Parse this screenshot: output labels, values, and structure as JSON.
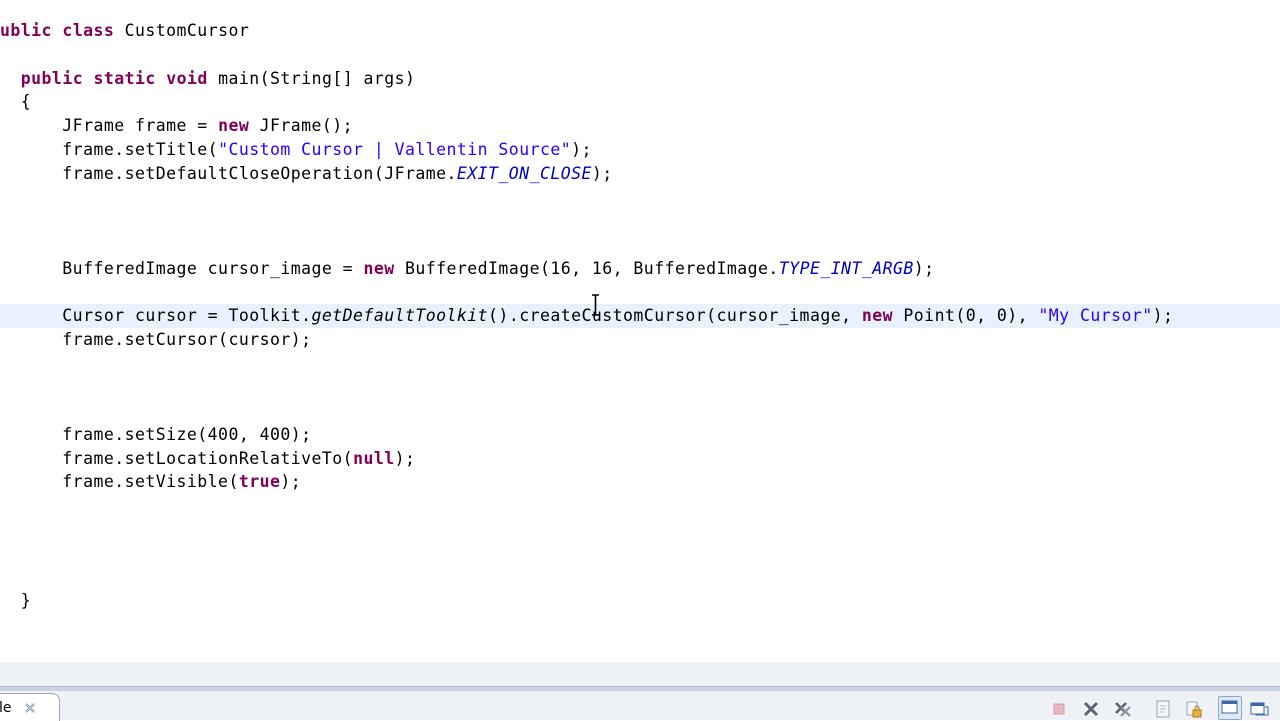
{
  "editor": {
    "lines": [
      [
        {
          "t": "ublic",
          "c": "kw"
        },
        {
          "t": " "
        },
        {
          "t": "class",
          "c": "kw"
        },
        {
          "t": " CustomCursor"
        }
      ],
      [],
      [
        {
          "t": "  "
        },
        {
          "t": "public",
          "c": "kw"
        },
        {
          "t": " "
        },
        {
          "t": "static",
          "c": "kw"
        },
        {
          "t": " "
        },
        {
          "t": "void",
          "c": "kw"
        },
        {
          "t": " main(String[] args)"
        }
      ],
      [
        {
          "t": "  {"
        }
      ],
      [
        {
          "t": "      JFrame frame = "
        },
        {
          "t": "new",
          "c": "kw"
        },
        {
          "t": " JFrame();"
        }
      ],
      [
        {
          "t": "      frame.setTitle("
        },
        {
          "t": "\"Custom Cursor | Vallentin Source\"",
          "c": "str"
        },
        {
          "t": ");"
        }
      ],
      [
        {
          "t": "      frame.setDefaultCloseOperation(JFrame."
        },
        {
          "t": "EXIT_ON_CLOSE",
          "c": "static"
        },
        {
          "t": ");"
        }
      ],
      [],
      [],
      [],
      [
        {
          "t": "      BufferedImage cursor_image = "
        },
        {
          "t": "new",
          "c": "kw"
        },
        {
          "t": " BufferedImage(16, 16, BufferedImage."
        },
        {
          "t": "TYPE_INT_ARGB",
          "c": "static"
        },
        {
          "t": ");"
        }
      ],
      [],
      [
        {
          "t": "      Cursor cursor = Toolkit."
        },
        {
          "t": "getDefaultToolkit",
          "c": "smethod"
        },
        {
          "t": "().createCustomCursor(cursor_image, "
        },
        {
          "t": "new",
          "c": "kw"
        },
        {
          "t": " Point(0, 0), "
        },
        {
          "t": "\"My Cursor\"",
          "c": "str"
        },
        {
          "t": ");"
        }
      ],
      [
        {
          "t": "      frame.setCursor(cursor);"
        }
      ],
      [],
      [],
      [],
      [
        {
          "t": "      frame.setSize(400, 400);"
        }
      ],
      [
        {
          "t": "      frame.setLocationRelativeTo("
        },
        {
          "t": "null",
          "c": "kw"
        },
        {
          "t": ");"
        }
      ],
      [
        {
          "t": "      frame.setVisible("
        },
        {
          "t": "true",
          "c": "kw"
        },
        {
          "t": ");"
        }
      ],
      [],
      [],
      [],
      [],
      [
        {
          "t": "  }"
        }
      ]
    ],
    "current_line_index": 12
  },
  "bottom_panel": {
    "tab_label": "le",
    "tab_close_icon": "close-icon"
  },
  "toolbar": {
    "icons": [
      "terminate-icon",
      "remove-launch-icon",
      "remove-all-terminated-icon",
      "clear-console-icon",
      "scroll-lock-icon",
      "display-selected-console-icon",
      "open-console-icon"
    ]
  },
  "colors": {
    "keyword": "#7f0055",
    "string": "#2a00ff",
    "static_field": "#0000c0",
    "current_line": "#e8f2fe"
  }
}
